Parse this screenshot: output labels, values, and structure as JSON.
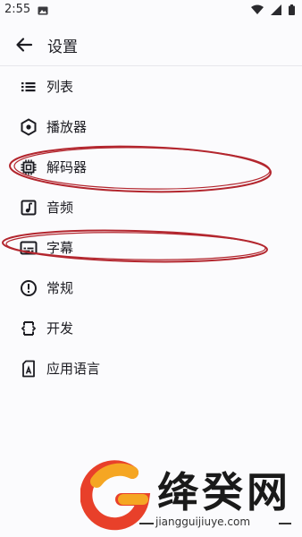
{
  "status_bar": {
    "time": "2:55",
    "icons": [
      "gallery-icon",
      "wifi-icon",
      "signal-icon",
      "battery-icon"
    ]
  },
  "app_bar": {
    "title": "设置",
    "back_icon": "arrow-back-icon"
  },
  "menu": {
    "items": [
      {
        "label": "列表",
        "icon": "list-icon"
      },
      {
        "label": "播放器",
        "icon": "player-icon"
      },
      {
        "label": "解码器",
        "icon": "chip-icon"
      },
      {
        "label": "音频",
        "icon": "music-note-icon"
      },
      {
        "label": "字幕",
        "icon": "subtitles-icon"
      },
      {
        "label": "常规",
        "icon": "info-icon"
      },
      {
        "label": "开发",
        "icon": "developer-icon"
      },
      {
        "label": "应用语言",
        "icon": "language-icon"
      }
    ]
  },
  "annotation_color": "#b3262e",
  "watermark": {
    "brand": "绛癸网",
    "url": "jiangguijiuye.com"
  }
}
